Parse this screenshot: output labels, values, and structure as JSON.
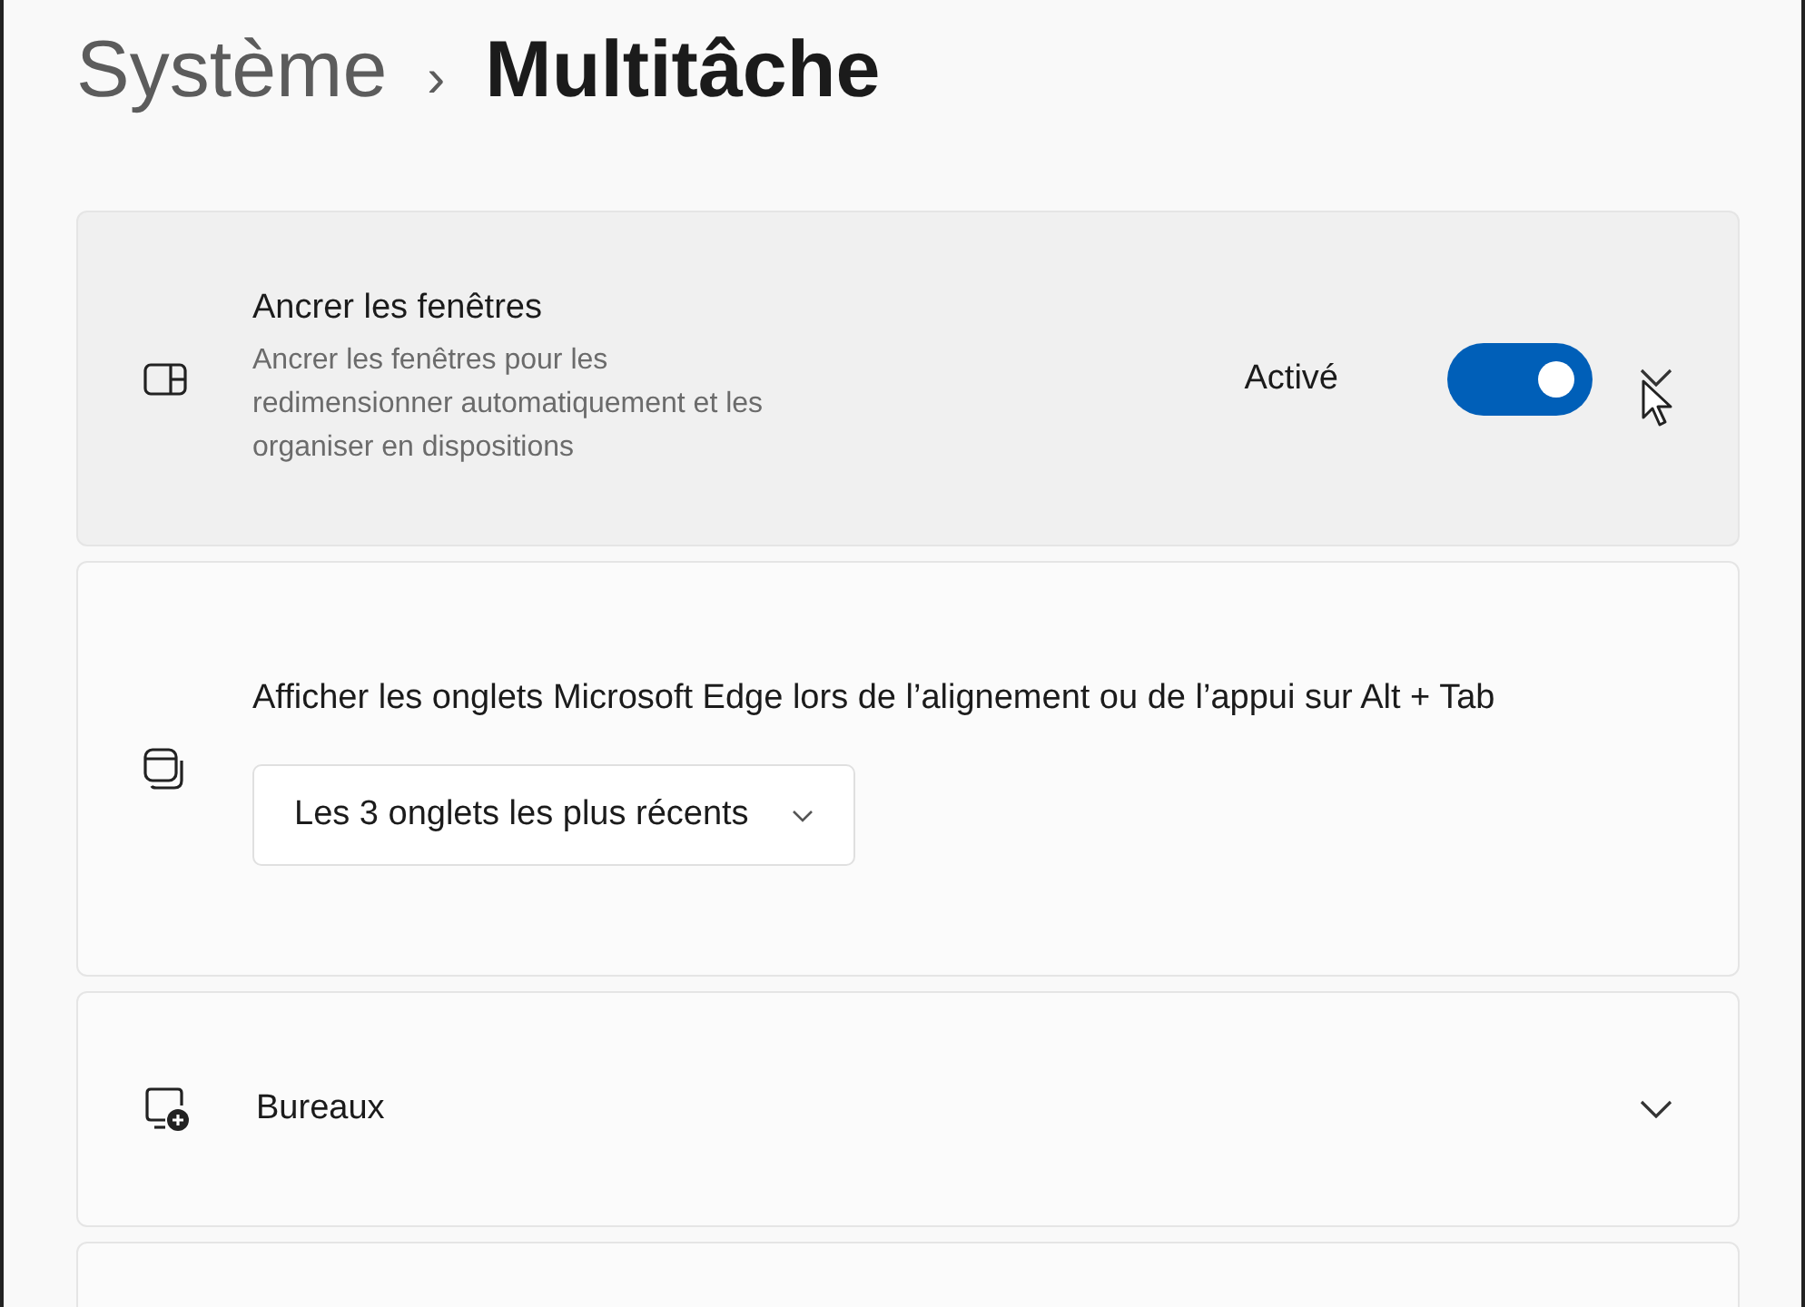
{
  "breadcrumb": {
    "parent": "Système",
    "separator": "›",
    "current": "Multitâche"
  },
  "cards": [
    {
      "kind": "toggle",
      "hovered": true,
      "title": "Ancrer les fenêtres",
      "description": "Ancrer les fenêtres pour les redimensionner automatiquement et les organiser en dispositions",
      "state_label": "Activé",
      "on": true
    },
    {
      "kind": "dropdown",
      "hovered": false,
      "title": "Afficher les onglets Microsoft Edge lors de l’alignement ou de l’appui sur Alt + Tab",
      "value": "Les 3 onglets les plus récents"
    },
    {
      "kind": "expander",
      "hovered": false,
      "title": "Bureaux"
    },
    {
      "kind": "empty",
      "hovered": false
    }
  ]
}
